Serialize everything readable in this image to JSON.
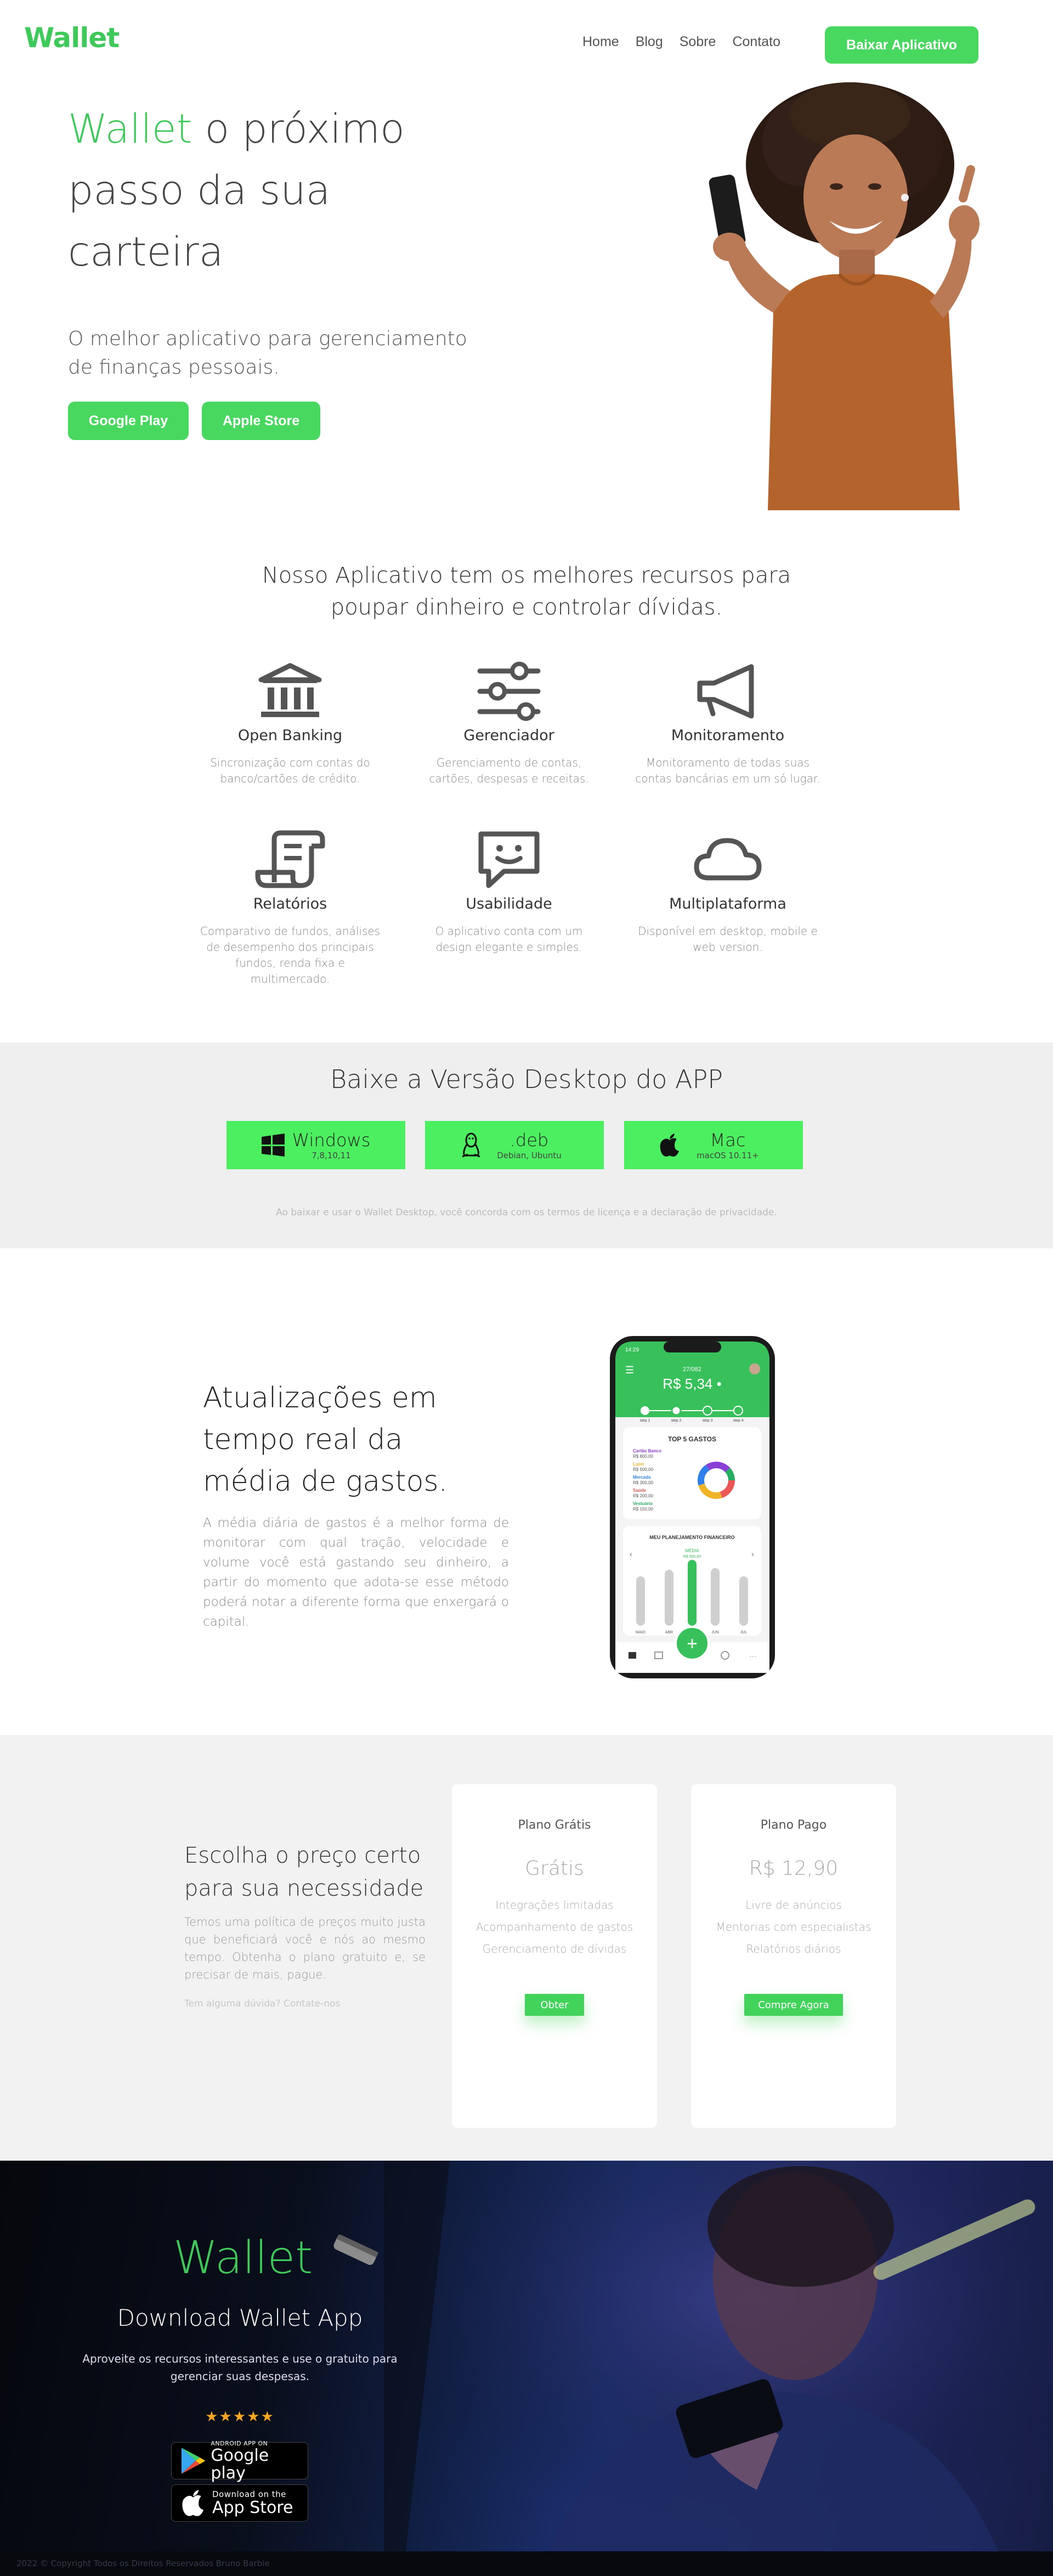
{
  "header": {
    "logo": "Wallet",
    "nav": [
      "Home",
      "Blog",
      "Sobre",
      "Contato"
    ],
    "cta": "Baixar Aplicativo"
  },
  "hero": {
    "title_highlight": "Wallet",
    "title_rest": " o próximo passo da sua carteira",
    "subtitle": "O melhor aplicativo para gerenciamento de finanças pessoais.",
    "btn_google": "Google Play",
    "btn_apple": "Apple Store"
  },
  "features": {
    "title": "Nosso Aplicativo tem os melhores recursos para poupar dinheiro e controlar dívidas.",
    "items": [
      {
        "icon": "bank-icon",
        "title": "Open Banking",
        "text": "Sincronização com contas do banco/cartões de crédito."
      },
      {
        "icon": "sliders-icon",
        "title": "Gerenciador",
        "text": "Gerenciamento de contas, cartões, despesas e receitas."
      },
      {
        "icon": "megaphone-icon",
        "title": "Monitoramento",
        "text": "Monitoramento de todas suas contas bancárias em um só lugar."
      },
      {
        "icon": "receipt-icon",
        "title": "Relatórios",
        "text": "Comparativo de fundos, análises de desempenho dos principais fundos, renda fixa e multimercado."
      },
      {
        "icon": "chat-smile-icon",
        "title": "Usabilidade",
        "text": "O aplicativo conta com um design elegante e simples."
      },
      {
        "icon": "cloud-icon",
        "title": "Multiplataforma",
        "text": "Disponível em desktop, mobile e web version."
      }
    ]
  },
  "desktop": {
    "title": "Baixe a Versão Desktop do APP",
    "buttons": [
      {
        "name": "Windows",
        "sub": "7,8,10,11"
      },
      {
        "name": ".deb",
        "sub": "Debian, Ubuntu"
      },
      {
        "name": "Mac",
        "sub": "macOS 10.11+"
      }
    ],
    "note": "Ao baixar e usar o Wallet Desktop, você concorda com os termos de licença e a declaração de privacidade."
  },
  "updates": {
    "title": "Atualizações em tempo real da média de gastos.",
    "text": "A média diária de gastos é a melhor forma de monitorar com qual tração, velocidade e volume você está gastando seu dinheiro, a partir do momento que adota-se esse método poderá notar a diferente forma que enxergará o capital."
  },
  "phone": {
    "time": "14:29",
    "date": "27/082",
    "balance": "R$ 5,34 •",
    "steps": [
      "step 1",
      "step 2",
      "step 3",
      "step 4"
    ],
    "top_title": "TOP 5 GASTOS",
    "top_items": [
      {
        "label": "Cartão Banco",
        "value": "R$ 800,00",
        "color": "#8b3fd9"
      },
      {
        "label": "Lazer",
        "value": "R$ 500,00",
        "color": "#f0b429"
      },
      {
        "label": "Mercado",
        "value": "R$ 300,00",
        "color": "#2f80ed"
      },
      {
        "label": "Saúde",
        "value": "R$ 200,00",
        "color": "#eb5757"
      },
      {
        "label": "Vestuário",
        "value": "R$ 150,00",
        "color": "#27ae60"
      }
    ],
    "plan_title": "MEU PLANEJAMENTO FINANCEIRO",
    "plan_label": "MÉDIA",
    "plan_value": "R$ 500,00",
    "months": [
      "MAIO",
      "ABR",
      "MAR",
      "JUN",
      "JUL"
    ]
  },
  "pricing": {
    "title": "Escolha o preço certo para sua necessidade",
    "text": "Temos uma política de preços muito justa que beneficiará você e nós ao mesmo tempo. Obtenha o plano gratuito e, se precisar de mais, pague.",
    "help": "Tem alguma dúvida? Contate-nos",
    "plans": [
      {
        "name": "Plano Grátis",
        "price": "Grátis",
        "features": [
          "Integrações limitadas",
          "Acompanhamento de gastos",
          "Gerenciamento de dívidas"
        ],
        "button": "Obter"
      },
      {
        "name": "Plano Pago",
        "price": "R$ 12,90",
        "features": [
          "Livre de anúncios",
          "Mentorias com especialistas",
          "Relatórios diários"
        ],
        "button": "Compre Agora"
      }
    ]
  },
  "footer": {
    "logo": "Wallet",
    "title": "Download Wallet App",
    "text": "Aproveite os recursos interessantes e use o gratuito para gerenciar suas despesas.",
    "stars": "★★★★★",
    "google_small": "ANDROID APP ON",
    "google_big": "Google play",
    "apple_small": "Download on the",
    "apple_big": "App Store",
    "copyright": "2022 © Copyright Todos os Direitos Reservados Bruno Barbie"
  },
  "colors": {
    "accent": "#3ec95a",
    "button": "#49d85f",
    "desktop_button": "#4cef5f"
  }
}
